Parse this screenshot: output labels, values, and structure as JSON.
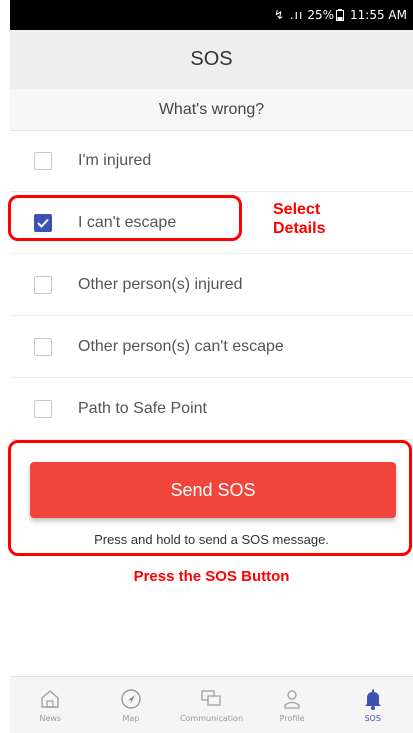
{
  "status_bar": {
    "signal": "↯ .ıı",
    "battery": "25%",
    "time": "11:55 AM"
  },
  "header": {
    "title": "SOS"
  },
  "section": {
    "title": "What's wrong?"
  },
  "options": [
    {
      "label": "I'm injured",
      "checked": false
    },
    {
      "label": "I can't escape",
      "checked": true
    },
    {
      "label": "Other person(s) injured",
      "checked": false
    },
    {
      "label": "Other person(s) can't escape",
      "checked": false
    },
    {
      "label": "Path to Safe Point",
      "checked": false
    }
  ],
  "annotations": {
    "select_line1": "Select",
    "select_line2": "Details",
    "press": "Press the SOS Button",
    "color": "#ff0000"
  },
  "send": {
    "label": "Send SOS",
    "hint": "Press and hold to send a SOS message."
  },
  "nav": {
    "items": [
      {
        "label": "News",
        "icon": "house-icon"
      },
      {
        "label": "Map",
        "icon": "compass-icon"
      },
      {
        "label": "Communication",
        "icon": "chat-icon"
      },
      {
        "label": "Profile",
        "icon": "person-icon"
      },
      {
        "label": "SOS",
        "icon": "bell-icon",
        "active": true
      }
    ]
  },
  "colors": {
    "accent": "#3e50b4",
    "sos_red": "#f0453a"
  }
}
